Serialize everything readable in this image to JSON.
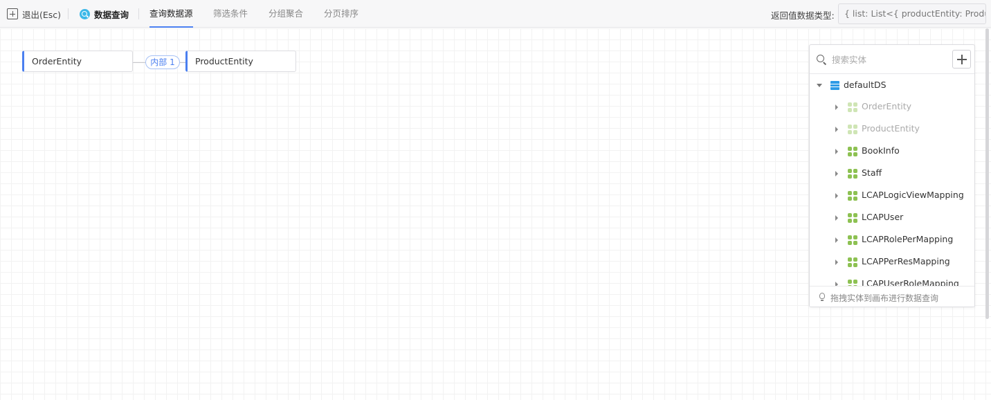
{
  "toolbar": {
    "exit_label": "退出(Esc)",
    "mode_label": "数据查询",
    "tabs": [
      {
        "label": "查询数据源",
        "active": true
      },
      {
        "label": "筛选条件",
        "active": false
      },
      {
        "label": "分组聚合",
        "active": false
      },
      {
        "label": "分页排序",
        "active": false
      }
    ],
    "return_type_label": "返回值数据类型:",
    "return_type_value": "{ list: List<{ productEntity: Product"
  },
  "canvas": {
    "left_entity": "OrderEntity",
    "join_label": "内部 1",
    "right_entity": "ProductEntity"
  },
  "panel": {
    "search_placeholder": "搜索实体",
    "root_label": "defaultDS",
    "items": [
      {
        "label": "OrderEntity",
        "dim": true
      },
      {
        "label": "ProductEntity",
        "dim": true
      },
      {
        "label": "BookInfo",
        "dim": false
      },
      {
        "label": "Staff",
        "dim": false
      },
      {
        "label": "LCAPLogicViewMapping",
        "dim": false
      },
      {
        "label": "LCAPUser",
        "dim": false
      },
      {
        "label": "LCAPRolePerMapping",
        "dim": false
      },
      {
        "label": "LCAPPerResMapping",
        "dim": false
      },
      {
        "label": "LCAPUserRoleMapping",
        "dim": false
      }
    ],
    "footer_hint": "拖拽实体到画布进行数据查询"
  },
  "colors": {
    "accent": "#4a7ff0",
    "entity_icon": "#8dc152",
    "datasource_icon": "#2e9be6"
  }
}
